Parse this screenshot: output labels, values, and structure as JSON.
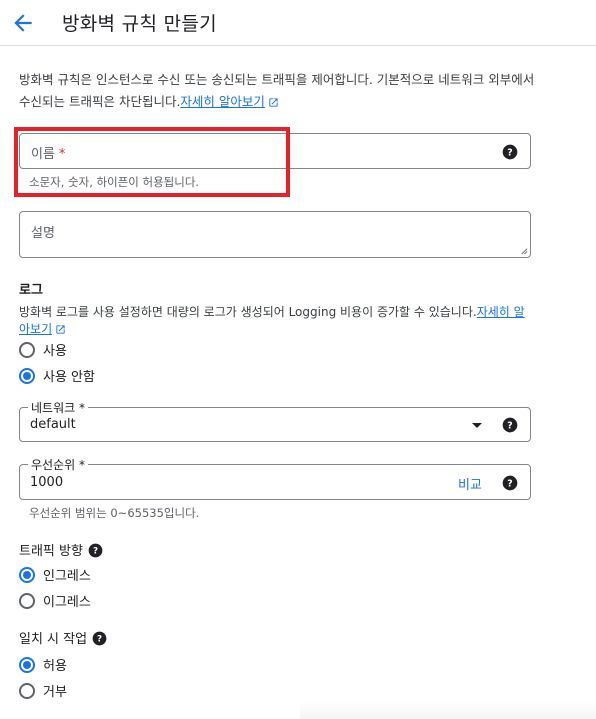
{
  "header": {
    "title": "방화벽 규칙 만들기"
  },
  "intro": {
    "text": "방화벽 규칙은 인스턴스로 수신 또는 송신되는 트래픽을 제어합니다. 기본적으로 네트워크 외부에서 수신되는 트래픽은 차단됩니다.",
    "link": "자세히 알아보기"
  },
  "name_field": {
    "placeholder": "이름",
    "required_mark": "*",
    "hint": "소문자, 숫자, 하이픈이 허용됩니다."
  },
  "description_field": {
    "placeholder": "설명"
  },
  "logs": {
    "title": "로그",
    "text": "방화벽 로그를 사용 설정하면 대량의 로그가 생성되어 Logging 비용이 증가할 수 있습니다.",
    "link": "자세히 알아보기",
    "options": [
      "사용",
      "사용 안함"
    ],
    "selected": "사용 안함"
  },
  "network": {
    "label": "네트워크 *",
    "value": "default"
  },
  "priority": {
    "label": "우선순위 *",
    "value": "1000",
    "compare": "비교",
    "hint": "우선순위 범위는 0~65535입니다."
  },
  "direction": {
    "title": "트래픽 방향",
    "options": [
      "인그레스",
      "이그레스"
    ],
    "selected": "인그레스"
  },
  "action": {
    "title": "일치 시 작업",
    "options": [
      "허용",
      "거부"
    ],
    "selected": "허용"
  },
  "colors": {
    "accent": "#1a73e8",
    "highlight": "#e8202b",
    "required": "#d93025"
  }
}
